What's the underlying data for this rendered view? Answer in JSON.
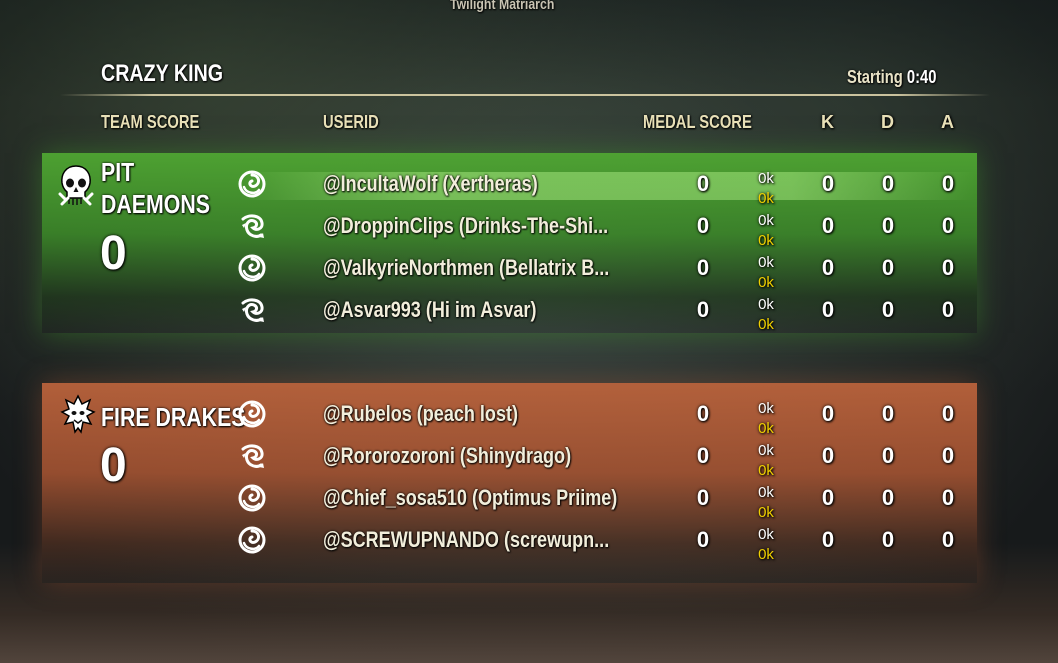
{
  "top_name": "Twilight Matriarch",
  "mode_title": "CRAZY KING",
  "status": {
    "label": "Starting",
    "time": "0:40"
  },
  "columns": {
    "team_score": "TEAM SCORE",
    "userid": "USERID",
    "medal_score": "MEDAL SCORE",
    "k": "K",
    "d": "D",
    "a": "A"
  },
  "teams": [
    {
      "name_line1": "PIT",
      "name_line2": "DAEMONS",
      "score": "0",
      "color": "#4f9e34",
      "icon": "skull-icon",
      "players": [
        {
          "class_icon": "class-swirl-icon",
          "userid": "@IncultaWolf (Xertheras)",
          "medal": "0",
          "stat1": "0k",
          "stat2": "0k",
          "k": "0",
          "d": "0",
          "a": "0"
        },
        {
          "class_icon": "class-dragon-icon",
          "userid": "@DroppinClips (Drinks-The-Shi...",
          "medal": "0",
          "stat1": "0k",
          "stat2": "0k",
          "k": "0",
          "d": "0",
          "a": "0"
        },
        {
          "class_icon": "class-swirl-icon",
          "userid": "@ValkyrieNorthmen (Bellatrix B...",
          "medal": "0",
          "stat1": "0k",
          "stat2": "0k",
          "k": "0",
          "d": "0",
          "a": "0"
        },
        {
          "class_icon": "class-dragon-icon",
          "userid": "@Asvar993 (Hi im Asvar)",
          "medal": "0",
          "stat1": "0k",
          "stat2": "0k",
          "k": "0",
          "d": "0",
          "a": "0"
        }
      ]
    },
    {
      "name_line1": "FIRE DRAKES",
      "score": "0",
      "color": "#b3603b",
      "icon": "drake-icon",
      "players": [
        {
          "class_icon": "class-swirl-icon",
          "userid": "@Rubelos (peach lost)",
          "medal": "0",
          "stat1": "0k",
          "stat2": "0k",
          "k": "0",
          "d": "0",
          "a": "0"
        },
        {
          "class_icon": "class-dragon-icon",
          "userid": "@Rororozoroni (Shinydrago)",
          "medal": "0",
          "stat1": "0k",
          "stat2": "0k",
          "k": "0",
          "d": "0",
          "a": "0"
        },
        {
          "class_icon": "class-swirl-icon",
          "userid": "@Chief_sosa510 (Optimus Priime)",
          "medal": "0",
          "stat1": "0k",
          "stat2": "0k",
          "k": "0",
          "d": "0",
          "a": "0"
        },
        {
          "class_icon": "class-swirl-icon",
          "userid": "@SCREWUPNANDO (screwupn...",
          "medal": "0",
          "stat1": "0k",
          "stat2": "0k",
          "k": "0",
          "d": "0",
          "a": "0"
        }
      ]
    }
  ]
}
